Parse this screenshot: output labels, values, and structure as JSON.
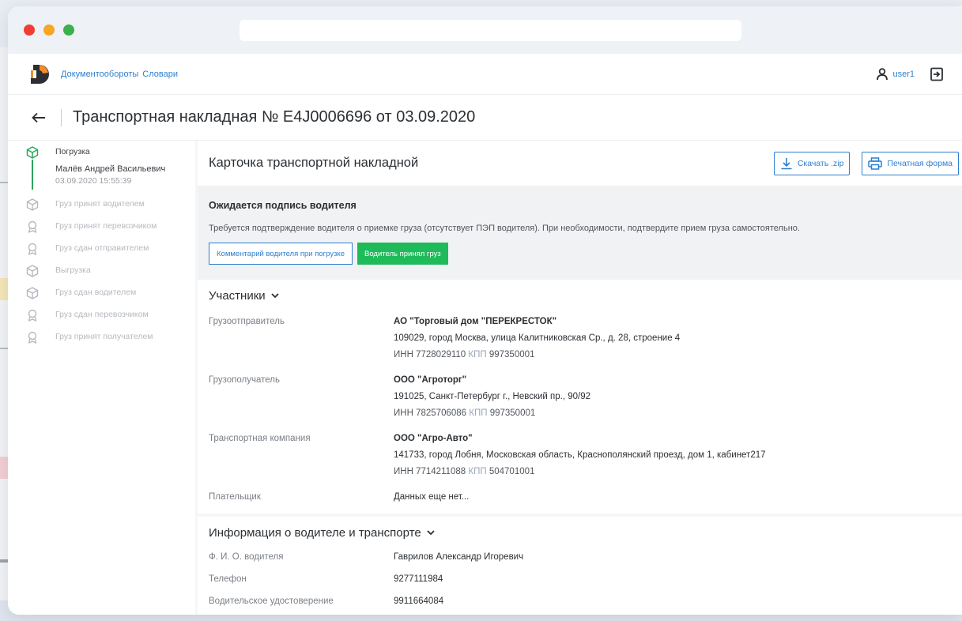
{
  "app": {
    "nav": [
      "Документообороты",
      "Словари"
    ],
    "user": "user1"
  },
  "page": {
    "title": "Транспортная накладная № E4J0006696 от 03.09.2020"
  },
  "sidebar": {
    "steps": [
      {
        "label": "Погрузка",
        "active": true,
        "person": "Малёв Андрей Васильевич",
        "date": "03.09.2020 15:55:39",
        "icon": "box-icon"
      },
      {
        "label": "Груз принят водителем",
        "active": false,
        "icon": "box-icon"
      },
      {
        "label": "Груз принят перевозчиком",
        "active": false,
        "icon": "award-icon"
      },
      {
        "label": "Груз сдан отправителем",
        "active": false,
        "icon": "award-icon"
      },
      {
        "label": "Выгрузка",
        "active": false,
        "icon": "box-icon"
      },
      {
        "label": "Груз сдан водителем",
        "active": false,
        "icon": "box-icon"
      },
      {
        "label": "Груз сдан перевозчиком",
        "active": false,
        "icon": "award-icon"
      },
      {
        "label": "Груз принят получателем",
        "active": false,
        "icon": "award-icon"
      }
    ]
  },
  "card": {
    "title": "Карточка транспортной накладной",
    "download_label": "Скачать .zip",
    "print_label": "Печатная форма"
  },
  "notice": {
    "title": "Ожидается подпись водителя",
    "text": "Требуется подтверждение водителя о приемке груза (отсутствует ПЭП водителя). При необходимости, подтвердите прием груза самостоятельно.",
    "comment_btn": "Комментарий водителя при погрузке",
    "accept_btn": "Водитель принял груз"
  },
  "participants": {
    "title": "Участники",
    "rows": [
      {
        "label": "Грузоотправитель",
        "name": "АО \"Торговый дом \"ПЕРЕКРЕСТОК\"",
        "address": "109029, город Москва, улица Калитниковская Ср., д. 28, строение 4",
        "inn_label": "ИНН",
        "inn": "7728029110",
        "kpp_label": "КПП",
        "kpp": "997350001"
      },
      {
        "label": "Грузополучатель",
        "name": "ООО \"Агроторг\"",
        "address": "191025, Санкт-Петербург г., Невский пр., 90/92",
        "inn_label": "ИНН",
        "inn": "7825706086",
        "kpp_label": "КПП",
        "kpp": "997350001"
      },
      {
        "label": "Транспортная компания",
        "name": "ООО \"Агро-Авто\"",
        "address": "141733, город Лобня, Московская область, Краснополянский проезд, дом 1, кабинет217",
        "inn_label": "ИНН",
        "inn": "7714211088",
        "kpp_label": "КПП",
        "kpp": "504701001"
      }
    ],
    "payer_label": "Плательщик",
    "payer_value": "Данных еще нет..."
  },
  "driver": {
    "title": "Информация о водителе и транспорте",
    "rows": [
      {
        "label": "Ф. И. О. водителя",
        "value": "Гаврилов Александр Игоревич"
      },
      {
        "label": "Телефон",
        "value": "9277111984"
      },
      {
        "label": "Водительское удостоверение",
        "value": "9911664084"
      }
    ]
  },
  "colors": {
    "accent": "#2d7fd0",
    "success": "#1fbb5a",
    "timeline": "#2aa65a"
  }
}
